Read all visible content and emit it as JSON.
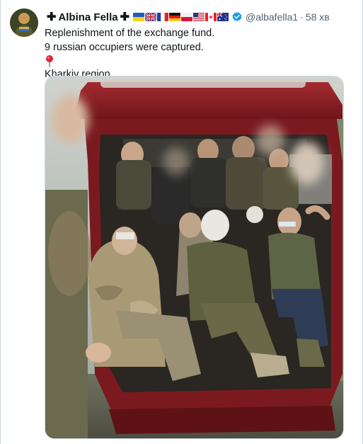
{
  "tweet": {
    "author": {
      "name": "Albina Fella",
      "prefix_symbol": "✚",
      "suffix_symbol": "✚",
      "flags": [
        "ukraine-flag",
        "uk-flag",
        "france-flag",
        "germany-flag",
        "poland-flag",
        "usa-flag",
        "canada-flag",
        "australia-flag"
      ],
      "verified_icon": "verified-badge-icon",
      "handle": "@albafella1",
      "separator": "·",
      "time": "58 хв"
    },
    "text": {
      "line1": "Replenishment of the exchange fund.",
      "line2": "9 russian occupiers were captured.",
      "line3_icon": "round-pushpin-icon",
      "line3": "Kharkiv region"
    },
    "media": {
      "type": "photo",
      "icon": "photo-prisoners-in-vehicle"
    }
  },
  "colors": {
    "text_primary": "#0f1419",
    "text_secondary": "#536471",
    "verified_blue": "#1d9bf0",
    "border": "#cfd9de",
    "vehicle_red": "#8c1f24"
  }
}
